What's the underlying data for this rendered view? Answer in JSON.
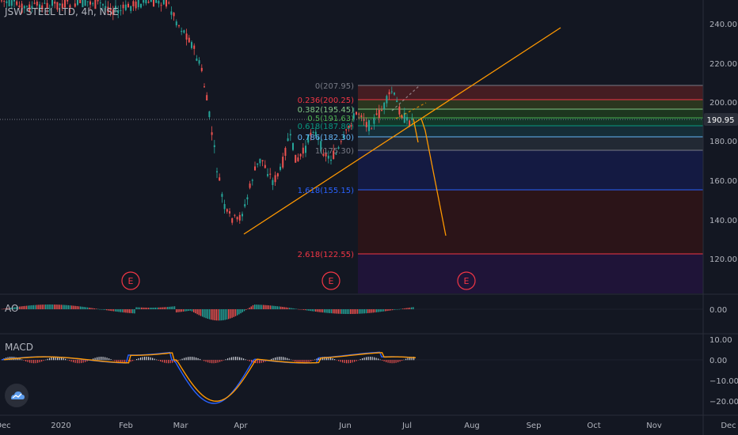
{
  "header": {
    "symbol": "JSW STEEL LTD, 4h, NSE"
  },
  "price_axis": {
    "ticks": [
      "240.00",
      "220.00",
      "200.00",
      "180.00",
      "160.00",
      "140.00",
      "120.00"
    ],
    "last_price": "190.95",
    "last_price_color": "#2962ff"
  },
  "fib_levels": [
    {
      "label": "0(207.95)",
      "color": "#787b86"
    },
    {
      "label": "0.236(200.25)",
      "color": "#f23645"
    },
    {
      "label": "0.382(195.45)",
      "color": "#81c784"
    },
    {
      "label": "0.5(191.63)",
      "color": "#4caf50"
    },
    {
      "label": "0.618(187.80)",
      "color": "#089981"
    },
    {
      "label": "0.786(182.30)",
      "color": "#64b5f6"
    },
    {
      "label": "1(175.30)",
      "color": "#787b86"
    },
    {
      "label": "1.618(155.15)",
      "color": "#2962ff"
    },
    {
      "label": "2.618(122.55)",
      "color": "#f23645"
    }
  ],
  "earnings_markers": [
    "E",
    "E",
    "E"
  ],
  "ao": {
    "title": "AO",
    "ticks": [
      "0.00"
    ]
  },
  "macd": {
    "title": "MACD",
    "ticks": [
      "10.00",
      "0.00",
      "−10.00",
      "−20.00"
    ]
  },
  "time_axis": {
    "labels": [
      "Dec",
      "2020",
      "Feb",
      "Mar",
      "Apr",
      "Jun",
      "Jul",
      "Aug",
      "Sep",
      "Oct",
      "Nov",
      "Dec"
    ]
  },
  "colors": {
    "up": "#26a69a",
    "down": "#ef5350",
    "trend": "#ff9800",
    "macd": "#2962ff",
    "signal": "#ff9800"
  }
}
